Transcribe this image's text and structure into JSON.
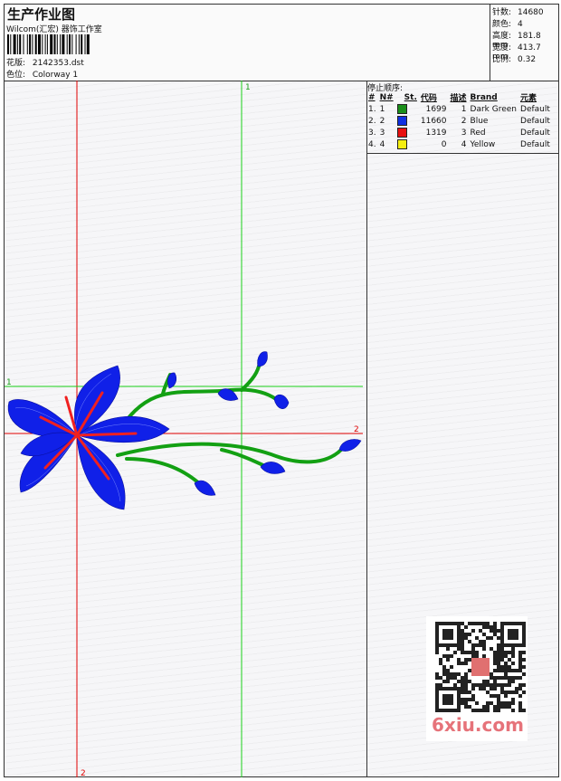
{
  "header": {
    "title": "生产作业图",
    "subtitle": "Wilcom(汇宏) 器饰工作室",
    "pattern_label": "花版:",
    "pattern_value": "2142353.dst",
    "color_label": "色位:",
    "color_value": "Colorway 1"
  },
  "stats": {
    "stitches_label": "针数:",
    "stitches_value": "14680",
    "colors_label": "颜色:",
    "colors_value": "4",
    "height_label": "高度:",
    "height_value": "181.8 mm",
    "width_label": "宽度:",
    "width_value": "413.7 mm",
    "scale_label": "比例:",
    "scale_value": "0.32"
  },
  "stops": {
    "caption": "停止顺序:",
    "headers": [
      "#",
      "N#",
      "St.",
      "代码",
      "描述",
      "Brand",
      "元素"
    ],
    "rows": [
      {
        "num": "1.",
        "n": "1",
        "color": "#1a8f1a",
        "st": "1699",
        "code": "1",
        "desc": "Dark Green",
        "brand": "Default"
      },
      {
        "num": "2.",
        "n": "2",
        "color": "#1030e0",
        "st": "11660",
        "code": "2",
        "desc": "Blue",
        "brand": "Default"
      },
      {
        "num": "3.",
        "n": "3",
        "color": "#e81010",
        "st": "1319",
        "code": "3",
        "desc": "Red",
        "brand": "Default"
      },
      {
        "num": "4.",
        "n": "4",
        "color": "#f4ee10",
        "st": "0",
        "code": "4",
        "desc": "Yellow",
        "brand": "Default"
      }
    ]
  },
  "canvas": {
    "axis_red_label_v": "2",
    "axis_red_label_h": "2",
    "axis_green_label_v": "1",
    "axis_green_label_h": "1",
    "colors": {
      "green": "#13a013",
      "blue": "#1020e8",
      "red": "#f02020",
      "axis_red": "#e00000",
      "axis_green": "#19d019"
    }
  },
  "watermark": {
    "brand_text": "6xiu.com"
  }
}
